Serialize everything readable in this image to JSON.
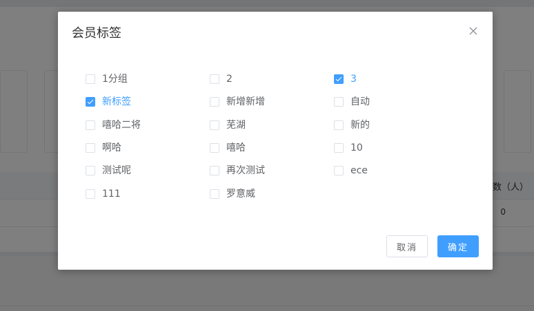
{
  "background": {
    "table_header_text": "人数（人）",
    "table_cell_value": "0"
  },
  "dialog": {
    "title": "会员标签",
    "close_icon": "close-icon",
    "tags": [
      {
        "label": "1分组",
        "checked": false
      },
      {
        "label": "2",
        "checked": false
      },
      {
        "label": "3",
        "checked": true
      },
      {
        "label": "新标签",
        "checked": true
      },
      {
        "label": "新增新增",
        "checked": false
      },
      {
        "label": "自动",
        "checked": false
      },
      {
        "label": "嘻哈二将",
        "checked": false
      },
      {
        "label": "芜湖",
        "checked": false
      },
      {
        "label": "新的",
        "checked": false
      },
      {
        "label": "啊哈",
        "checked": false
      },
      {
        "label": "嘻哈",
        "checked": false
      },
      {
        "label": "10",
        "checked": false
      },
      {
        "label": "测试呢",
        "checked": false
      },
      {
        "label": "再次测试",
        "checked": false
      },
      {
        "label": "ece",
        "checked": false
      },
      {
        "label": "111",
        "checked": false
      },
      {
        "label": "罗意威",
        "checked": false
      }
    ],
    "cancel_label": "取消",
    "ok_label": "确定"
  },
  "colors": {
    "primary": "#409eff",
    "overlay": "rgba(0,0,0,0.5)"
  }
}
